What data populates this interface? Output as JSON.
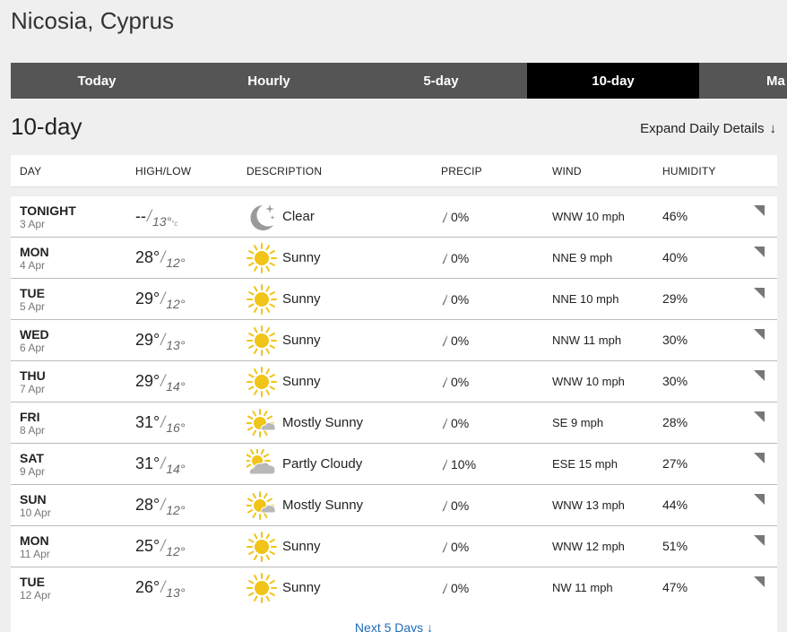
{
  "location": "Nicosia, Cyprus",
  "tabs": [
    "Today",
    "Hourly",
    "5-day",
    "10-day",
    "Ma"
  ],
  "active_tab": "10-day",
  "section_title": "10-day",
  "expand_label": "Expand Daily Details",
  "expand_arrow": "↓",
  "columns": {
    "day": "DAY",
    "highlow": "HIGH/LOW",
    "description": "DESCRIPTION",
    "precip": "PRECIP",
    "wind": "WIND",
    "humidity": "HUMIDITY"
  },
  "temp_unit": "°c",
  "rows": [
    {
      "day": "TONIGHT",
      "date": "3 Apr",
      "high": "--",
      "low": "13°",
      "icon": "moon-icon",
      "desc": "Clear",
      "precip": "0%",
      "wind": "WNW 10 mph",
      "humidity": "46%"
    },
    {
      "day": "MON",
      "date": "4 Apr",
      "high": "28°",
      "low": "12°",
      "icon": "sun-icon",
      "desc": "Sunny",
      "precip": "0%",
      "wind": "NNE 9 mph",
      "humidity": "40%"
    },
    {
      "day": "TUE",
      "date": "5 Apr",
      "high": "29°",
      "low": "12°",
      "icon": "sun-icon",
      "desc": "Sunny",
      "precip": "0%",
      "wind": "NNE 10 mph",
      "humidity": "29%"
    },
    {
      "day": "WED",
      "date": "6 Apr",
      "high": "29°",
      "low": "13°",
      "icon": "sun-icon",
      "desc": "Sunny",
      "precip": "0%",
      "wind": "NNW 11 mph",
      "humidity": "30%"
    },
    {
      "day": "THU",
      "date": "7 Apr",
      "high": "29°",
      "low": "14°",
      "icon": "sun-icon",
      "desc": "Sunny",
      "precip": "0%",
      "wind": "WNW 10 mph",
      "humidity": "30%"
    },
    {
      "day": "FRI",
      "date": "8 Apr",
      "high": "31°",
      "low": "16°",
      "icon": "mostly-sunny-icon",
      "desc": "Mostly Sunny",
      "precip": "0%",
      "wind": "SE 9 mph",
      "humidity": "28%"
    },
    {
      "day": "SAT",
      "date": "9 Apr",
      "high": "31°",
      "low": "14°",
      "icon": "partly-cloudy-icon",
      "desc": "Partly Cloudy",
      "precip": "10%",
      "wind": "ESE 15 mph",
      "humidity": "27%"
    },
    {
      "day": "SUN",
      "date": "10 Apr",
      "high": "28°",
      "low": "12°",
      "icon": "mostly-sunny-icon",
      "desc": "Mostly Sunny",
      "precip": "0%",
      "wind": "WNW 13 mph",
      "humidity": "44%"
    },
    {
      "day": "MON",
      "date": "11 Apr",
      "high": "25°",
      "low": "12°",
      "icon": "sun-icon",
      "desc": "Sunny",
      "precip": "0%",
      "wind": "WNW 12 mph",
      "humidity": "51%"
    },
    {
      "day": "TUE",
      "date": "12 Apr",
      "high": "26°",
      "low": "13°",
      "icon": "sun-icon",
      "desc": "Sunny",
      "precip": "0%",
      "wind": "NW 11 mph",
      "humidity": "47%"
    }
  ],
  "next_label": "Next 5 Days",
  "next_arrow": "↓",
  "colors": {
    "tab_bar": "#555555",
    "tab_active": "#000000",
    "sun": "#f0c419",
    "cloud": "#b8b8b8",
    "moon": "#9a9a9a",
    "link": "#1e6bb8"
  }
}
